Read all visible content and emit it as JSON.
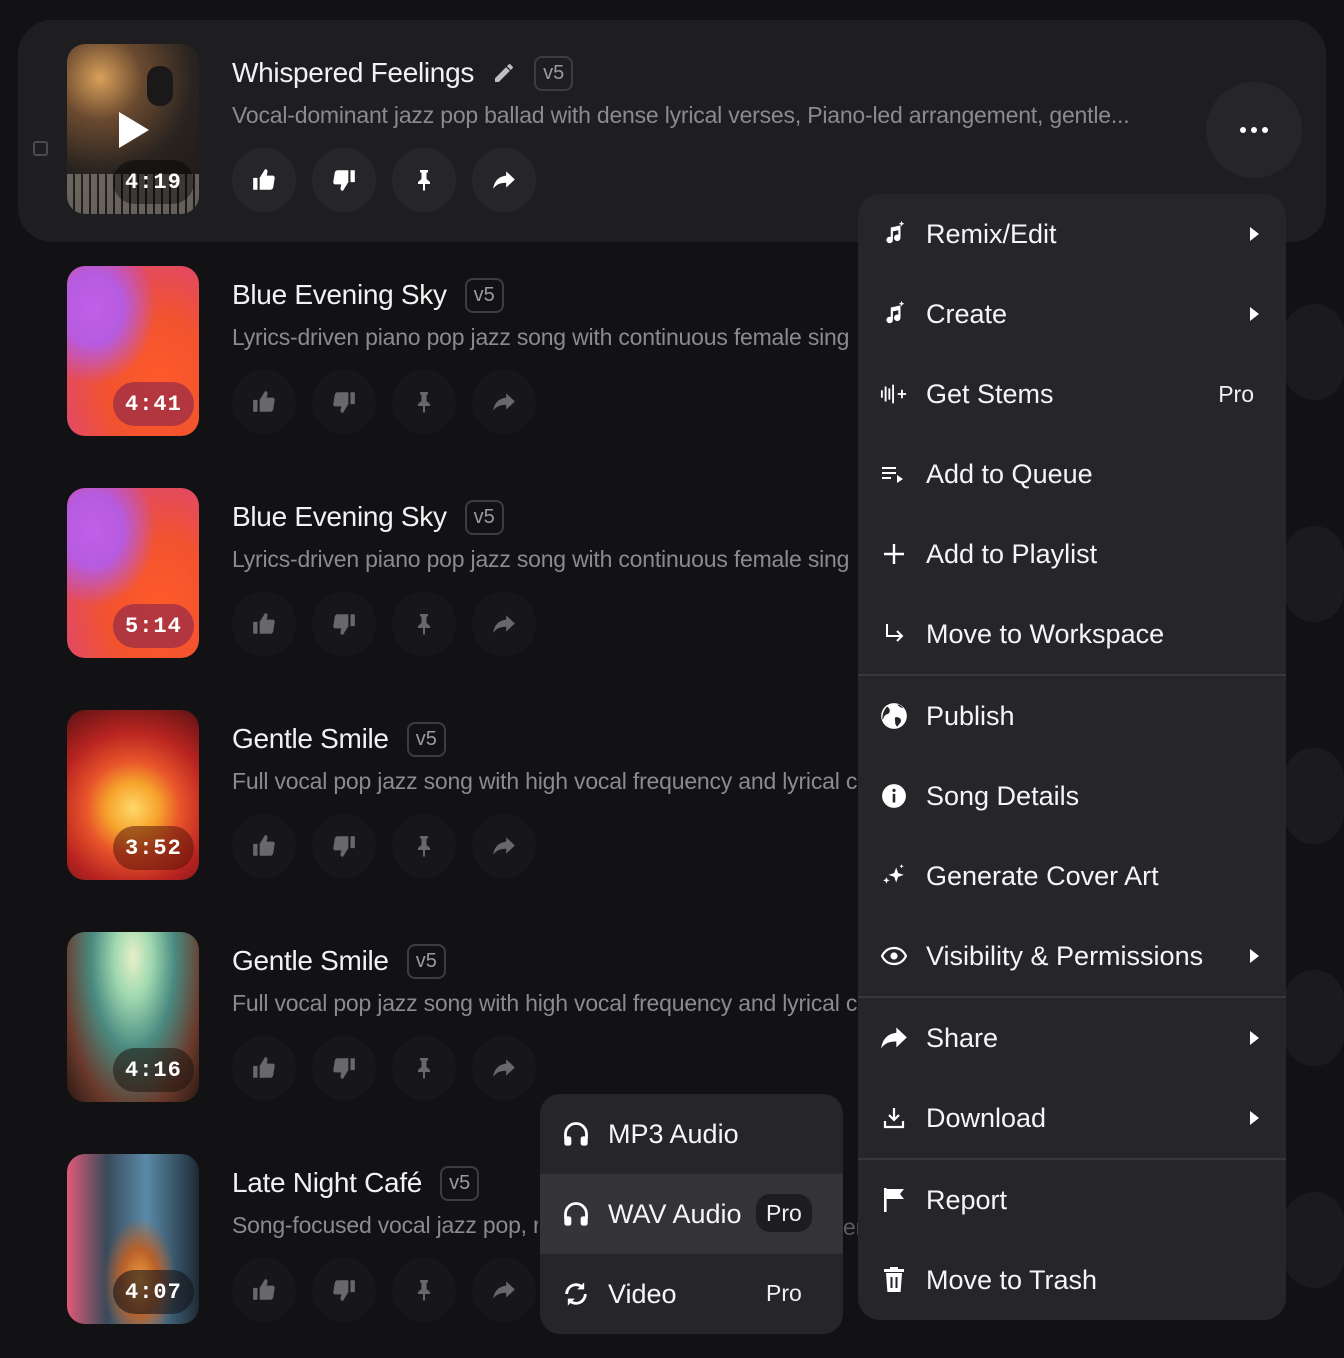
{
  "songs": [
    {
      "title": "Whispered Feelings",
      "version": "v5",
      "description": "Vocal-dominant jazz pop ballad with dense lyrical verses, Piano-led arrangement, gentle...",
      "duration": "4:19"
    },
    {
      "title": "Blue Evening Sky",
      "version": "v5",
      "description": "Lyrics-driven piano pop jazz song with continuous female sing",
      "duration": "4:41"
    },
    {
      "title": "Blue Evening Sky",
      "version": "v5",
      "description": "Lyrics-driven piano pop jazz song with continuous female sing",
      "duration": "5:14"
    },
    {
      "title": "Gentle Smile",
      "version": "v5",
      "description": "Full vocal pop jazz song with high vocal frequency and lyrical c",
      "duration": "3:52"
    },
    {
      "title": "Gentle Smile",
      "version": "v5",
      "description": "Full vocal pop jazz song with high vocal frequency and lyrical c",
      "duration": "4:16"
    },
    {
      "title": "Late Night Café",
      "version": "v5",
      "description": "Song-focused vocal jazz pop, r",
      "duration": "4:07"
    }
  ],
  "context_menu": {
    "items": [
      {
        "label": "Remix/Edit",
        "icon": "music-sparkle-icon",
        "has_submenu": true
      },
      {
        "label": "Create",
        "icon": "music-sparkle-icon",
        "has_submenu": true
      },
      {
        "label": "Get Stems",
        "icon": "waveform-plus-icon",
        "badge": "Pro"
      },
      {
        "label": "Add to Queue",
        "icon": "queue-icon"
      },
      {
        "label": "Add to Playlist",
        "icon": "plus-icon"
      },
      {
        "label": "Move to Workspace",
        "icon": "arrow-turn-icon"
      },
      {
        "label": "Publish",
        "icon": "globe-icon"
      },
      {
        "label": "Song Details",
        "icon": "info-icon"
      },
      {
        "label": "Generate Cover Art",
        "icon": "sparkles-icon"
      },
      {
        "label": "Visibility & Permissions",
        "icon": "eye-icon",
        "has_submenu": true
      },
      {
        "label": "Share",
        "icon": "share-arrow-icon",
        "has_submenu": true
      },
      {
        "label": "Download",
        "icon": "download-icon",
        "has_submenu": true
      },
      {
        "label": "Report",
        "icon": "flag-icon"
      },
      {
        "label": "Move to Trash",
        "icon": "trash-icon"
      }
    ]
  },
  "download_submenu": {
    "items": [
      {
        "label": "MP3 Audio",
        "icon": "headphones-icon"
      },
      {
        "label": "WAV Audio",
        "icon": "headphones-icon",
        "badge": "Pro"
      },
      {
        "label": "Video",
        "icon": "video-loop-icon",
        "badge": "Pro"
      }
    ]
  },
  "colors": {
    "background": "#121214",
    "menu": "#26262a",
    "selected_row": "#1e1e21"
  }
}
